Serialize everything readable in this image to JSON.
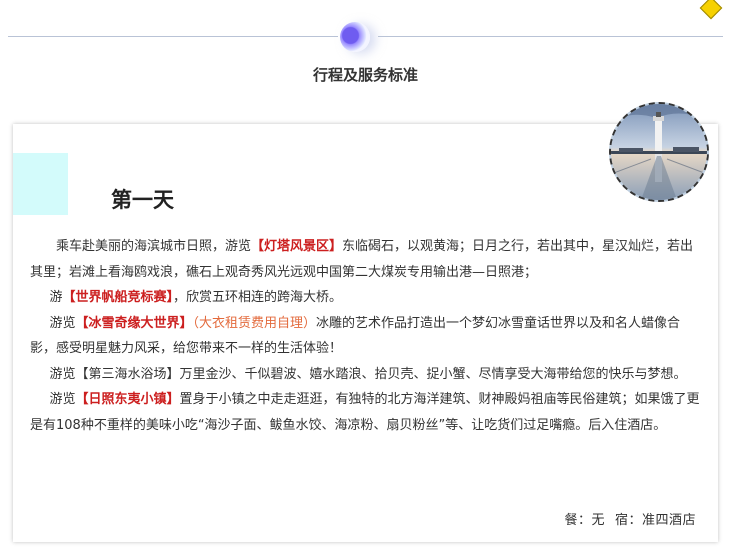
{
  "header": {
    "title": "行程及服务标准"
  },
  "day": {
    "title": "第一天",
    "p1": {
      "a": "乘车赴美丽的海滨城市日照，游览",
      "h": "【灯塔风景区】",
      "b": "东临碣石，以观黄海；日月之行，若出其中，星汉灿烂，若出其里；岩滩上看海鸥戏浪，礁石上观奇秀风光远观中国第二大煤炭专用输出港—日照港；"
    },
    "p2": {
      "a": "游",
      "h": "【世界帆船竞标赛】",
      "b": "，欣赏五环相连的跨海大桥。"
    },
    "p3": {
      "a": "游览",
      "h": "【冰雪奇缘大世界】",
      "n": "（大衣租赁费用自理）",
      "b": "冰雕的艺术作品打造出一个梦幻冰雪童话世界以及和名人蜡像合影，感受明星魅力风采，给您带来不一样的生活体验！"
    },
    "p4": {
      "a": "游览【第三海水浴场】万里金沙、千似碧波、嬉水踏浪、拾贝壳、捉小蟹、尽情享受大海带给您的快乐与梦想。"
    },
    "p5": {
      "a": "游览",
      "h": "【日照东夷小镇】",
      "b": "置身于小镇之中走走逛逛，有独特的北方海洋建筑、财神殿妈祖庙等民俗建筑；如果饿了更是有108种不重样的美味小吃“海沙子面、鲅鱼水饺、海凉粉、扇贝粉丝”等、让吃货们过足嘴瘾。后入住酒店。"
    },
    "meal": "餐：无",
    "hotel": "宿：准四酒店"
  },
  "colors": {
    "highlight": "#cc1f1f",
    "note": "#e36a3c",
    "accent_block": "#d3fbfb",
    "corner_diamond": "#f6d100"
  },
  "icons": {
    "divider": "gradient-orb-icon",
    "corner": "diamond-icon",
    "photo": "lighthouse-photo"
  }
}
